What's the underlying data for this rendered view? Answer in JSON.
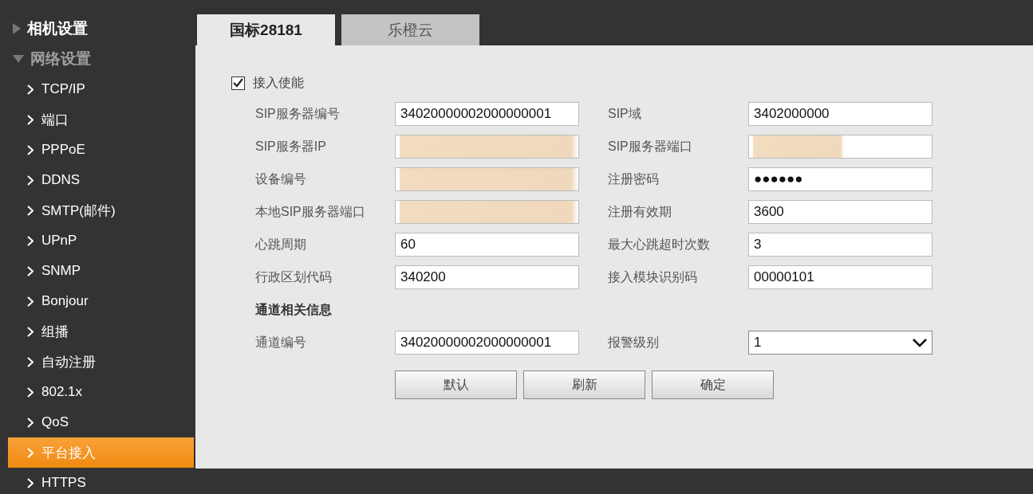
{
  "sidebar": {
    "sections": [
      {
        "label": "相机设置",
        "expanded": false
      },
      {
        "label": "网络设置",
        "expanded": true,
        "children": [
          {
            "label": "TCP/IP",
            "selected": false
          },
          {
            "label": "端口",
            "selected": false
          },
          {
            "label": "PPPoE",
            "selected": false
          },
          {
            "label": "DDNS",
            "selected": false
          },
          {
            "label": "SMTP(邮件)",
            "selected": false
          },
          {
            "label": "UPnP",
            "selected": false
          },
          {
            "label": "SNMP",
            "selected": false
          },
          {
            "label": "Bonjour",
            "selected": false
          },
          {
            "label": "组播",
            "selected": false
          },
          {
            "label": "自动注册",
            "selected": false
          },
          {
            "label": "802.1x",
            "selected": false
          },
          {
            "label": "QoS",
            "selected": false
          },
          {
            "label": "平台接入",
            "selected": true
          },
          {
            "label": "HTTPS",
            "selected": false
          }
        ]
      }
    ]
  },
  "tabs": [
    {
      "label": "国标28181",
      "selected": true
    },
    {
      "label": "乐橙云",
      "selected": false
    }
  ],
  "enable": {
    "label": "接入使能",
    "checked": true
  },
  "fields": [
    {
      "label": "SIP服务器编号",
      "kind": "text",
      "value": "34020000002000000001"
    },
    {
      "label": "SIP域",
      "kind": "text",
      "value": "3402000000"
    },
    {
      "label": "SIP服务器IP",
      "kind": "blurred"
    },
    {
      "label": "SIP服务器端口",
      "kind": "blurred-partial"
    },
    {
      "label": "设备编号",
      "kind": "blurred"
    },
    {
      "label": "注册密码",
      "kind": "password",
      "value": "●●●●●●"
    },
    {
      "label": "本地SIP服务器端口",
      "kind": "blurred"
    },
    {
      "label": "注册有效期",
      "kind": "text",
      "value": "3600"
    },
    {
      "label": "心跳周期",
      "kind": "text",
      "value": "60"
    },
    {
      "label": "最大心跳超时次数",
      "kind": "text",
      "value": "3"
    },
    {
      "label": "行政区划代码",
      "kind": "text",
      "value": "340200"
    },
    {
      "label": "接入模块识别码",
      "kind": "text",
      "value": "00000101"
    }
  ],
  "channel_section": {
    "heading": "通道相关信息",
    "fields": [
      {
        "label": "通道编号",
        "kind": "text",
        "value": "34020000002000000001"
      },
      {
        "label": "报警级别",
        "kind": "select",
        "value": "1"
      }
    ]
  },
  "buttons": [
    "默认",
    "刷新",
    "确定"
  ]
}
